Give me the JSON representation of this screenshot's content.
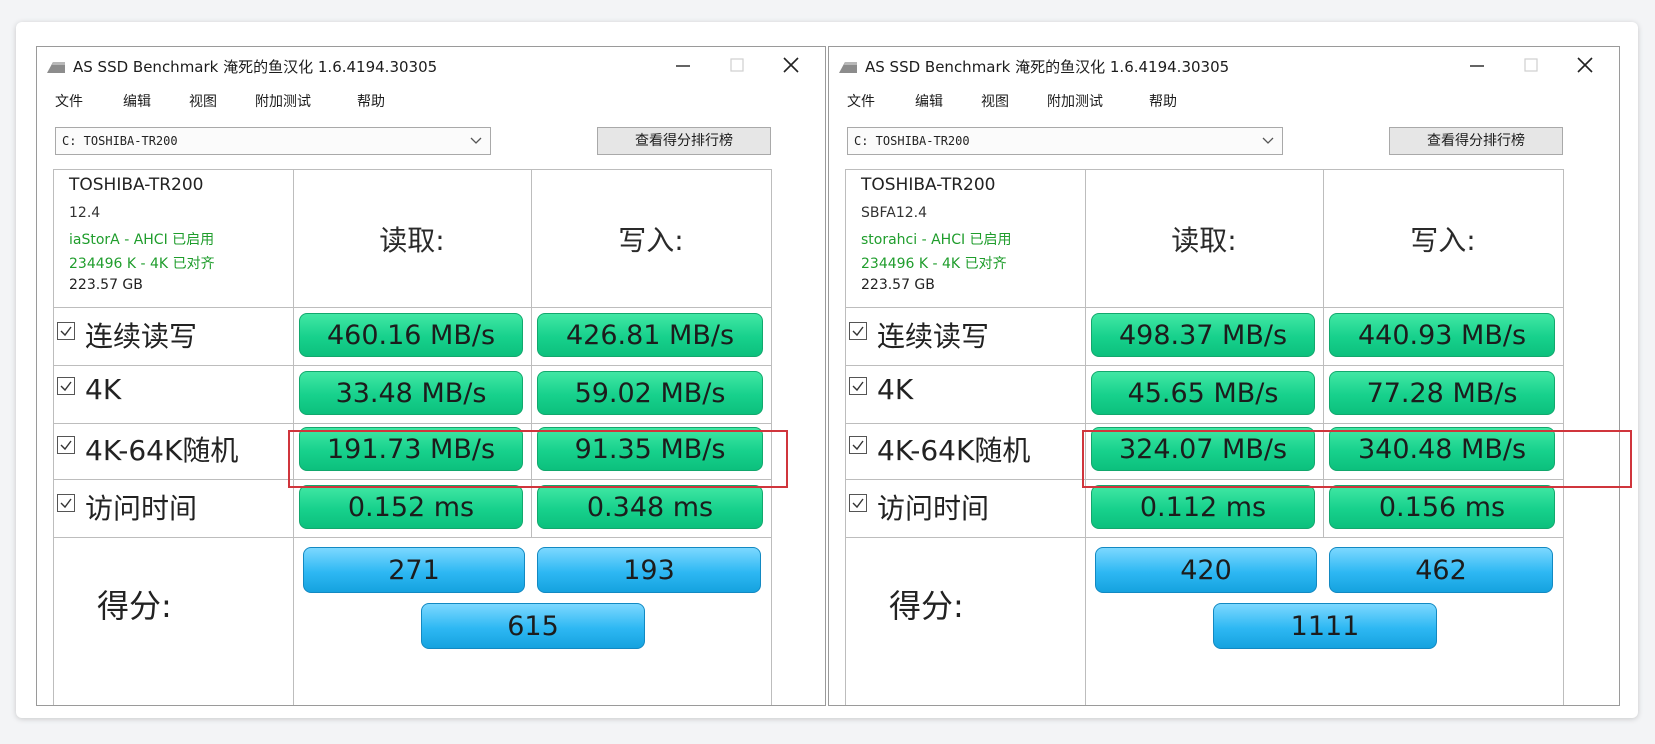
{
  "windows": [
    {
      "title": "AS SSD Benchmark 淹死的鱼汉化 1.6.4194.30305",
      "menu": [
        "文件",
        "编辑",
        "视图",
        "附加测试",
        "帮助"
      ],
      "drive_select": "C:  TOSHIBA-TR200",
      "rank_button": "查看得分排行榜",
      "drive_info": {
        "name": "TOSHIBA-TR200",
        "firmware": "12.4",
        "driver": "iaStorA - AHCI 已启用",
        "alignment": "234496 K - 4K 已对齐",
        "size": "223.57 GB"
      },
      "col_read": "读取:",
      "col_write": "写入:",
      "rows": [
        {
          "label": "连续读写",
          "read": "460.16 MB/s",
          "write": "426.81 MB/s"
        },
        {
          "label": "4K",
          "read": "33.48 MB/s",
          "write": "59.02 MB/s"
        },
        {
          "label": "4K-64K随机",
          "read": "191.73 MB/s",
          "write": "91.35 MB/s"
        },
        {
          "label": "访问时间",
          "read": "0.152 ms",
          "write": "0.348 ms"
        }
      ],
      "score_label": "得分:",
      "scores": {
        "read": "271",
        "write": "193",
        "total": "615"
      }
    },
    {
      "title": "AS SSD Benchmark 淹死的鱼汉化 1.6.4194.30305",
      "menu": [
        "文件",
        "编辑",
        "视图",
        "附加测试",
        "帮助"
      ],
      "drive_select": "C:  TOSHIBA-TR200",
      "rank_button": "查看得分排行榜",
      "drive_info": {
        "name": "TOSHIBA-TR200",
        "firmware": "SBFA12.4",
        "driver": "storahci - AHCI 已启用",
        "alignment": "234496 K - 4K 已对齐",
        "size": "223.57 GB"
      },
      "col_read": "读取:",
      "col_write": "写入:",
      "rows": [
        {
          "label": "连续读写",
          "read": "498.37 MB/s",
          "write": "440.93 MB/s"
        },
        {
          "label": "4K",
          "read": "45.65 MB/s",
          "write": "77.28 MB/s"
        },
        {
          "label": "4K-64K随机",
          "read": "324.07 MB/s",
          "write": "340.48 MB/s"
        },
        {
          "label": "访问时间",
          "read": "0.112 ms",
          "write": "0.156 ms"
        }
      ],
      "score_label": "得分:",
      "scores": {
        "read": "420",
        "write": "462",
        "total": "1111"
      }
    }
  ],
  "colors": {
    "result_green": "#17d18c",
    "score_blue": "#2eb8f3",
    "driver_text_green": "#1f9d2c",
    "highlight_red": "#d0353c"
  }
}
